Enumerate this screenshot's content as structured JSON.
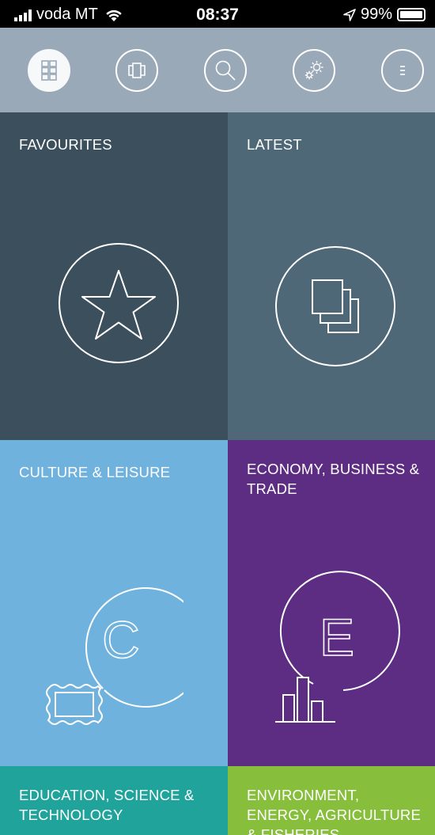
{
  "status_bar": {
    "carrier": "voda MT",
    "time": "08:37",
    "battery": "99%"
  },
  "toolbar": {
    "buttons": [
      {
        "icon": "grid-icon",
        "active": true
      },
      {
        "icon": "carousel-icon",
        "active": false
      },
      {
        "icon": "search-icon",
        "active": false
      },
      {
        "icon": "settings-gears-icon",
        "active": false
      },
      {
        "icon": "menu-icon",
        "active": false
      }
    ]
  },
  "tiles": [
    {
      "title": "FAVOURITES",
      "color": "#3b4f5c",
      "icon": "star-icon"
    },
    {
      "title": "LATEST",
      "color": "#4e6877",
      "icon": "stacked-documents-icon"
    },
    {
      "title": "CULTURE & LEISURE",
      "color": "#6fb2de",
      "icon": "culture-frame-icon"
    },
    {
      "title": "ECONOMY, BUSINESS & TRADE",
      "color": "#5c2d82",
      "icon": "economy-chart-icon"
    },
    {
      "title": "EDUCATION, SCIENCE & TECHNOLOGY",
      "color": "#1fa39b",
      "icon": ""
    },
    {
      "title": "ENVIRONMENT, ENERGY, AGRICULTURE & FISHERIES",
      "color": "#87bf3c",
      "icon": ""
    }
  ]
}
